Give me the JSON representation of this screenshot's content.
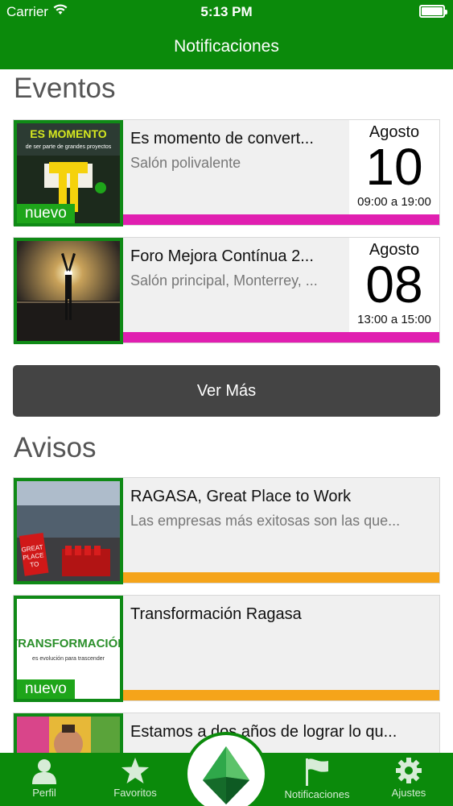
{
  "status_bar": {
    "carrier": "Carrier",
    "time": "5:13 PM"
  },
  "header": {
    "title": "Notificaciones"
  },
  "eventos": {
    "title": "Eventos",
    "items": [
      {
        "title": "Es momento de convert...",
        "location": "Salón polivalente",
        "month": "Agosto",
        "day": "10",
        "hours": "09:00 a 19:00",
        "badge": "nuevo",
        "thumb_text_1": "ES MOMENTO",
        "thumb_text_2": "de ser parte de grandes proyectos",
        "accent": "#e01fb0"
      },
      {
        "title": "Foro Mejora Contínua 2...",
        "location": "Salón principal, Monterrey, ...",
        "month": "Agosto",
        "day": "08",
        "hours": "13:00 a 15:00",
        "accent": "#e01fb0"
      }
    ],
    "more_button": "Ver Más"
  },
  "avisos": {
    "title": "Avisos",
    "items": [
      {
        "title": "RAGASA, Great Place to Work",
        "summary": "Las empresas más exitosas son las que...",
        "accent": "#f5a41a"
      },
      {
        "title": "Transformación Ragasa",
        "summary": "",
        "badge": "nuevo",
        "thumb_text_1": "TRANSFORMACIÓN",
        "thumb_text_2": "es evolución para trascender",
        "accent": "#f5a41a"
      },
      {
        "title": "Estamos a dos años de lograr lo qu...",
        "summary": ""
      }
    ]
  },
  "tabbar": {
    "tabs": [
      {
        "label": "Perfil",
        "icon": "person-icon"
      },
      {
        "label": "Favoritos",
        "icon": "star-icon"
      },
      {
        "label": "",
        "icon": "leaf-logo-icon"
      },
      {
        "label": "Notificaciones",
        "icon": "flag-icon"
      },
      {
        "label": "Ajustes",
        "icon": "gear-icon"
      }
    ]
  },
  "colors": {
    "brand_green": "#0b8a0b",
    "badge_green": "#1ea51a",
    "event_accent": "#e01fb0",
    "notice_accent": "#f5a41a"
  }
}
